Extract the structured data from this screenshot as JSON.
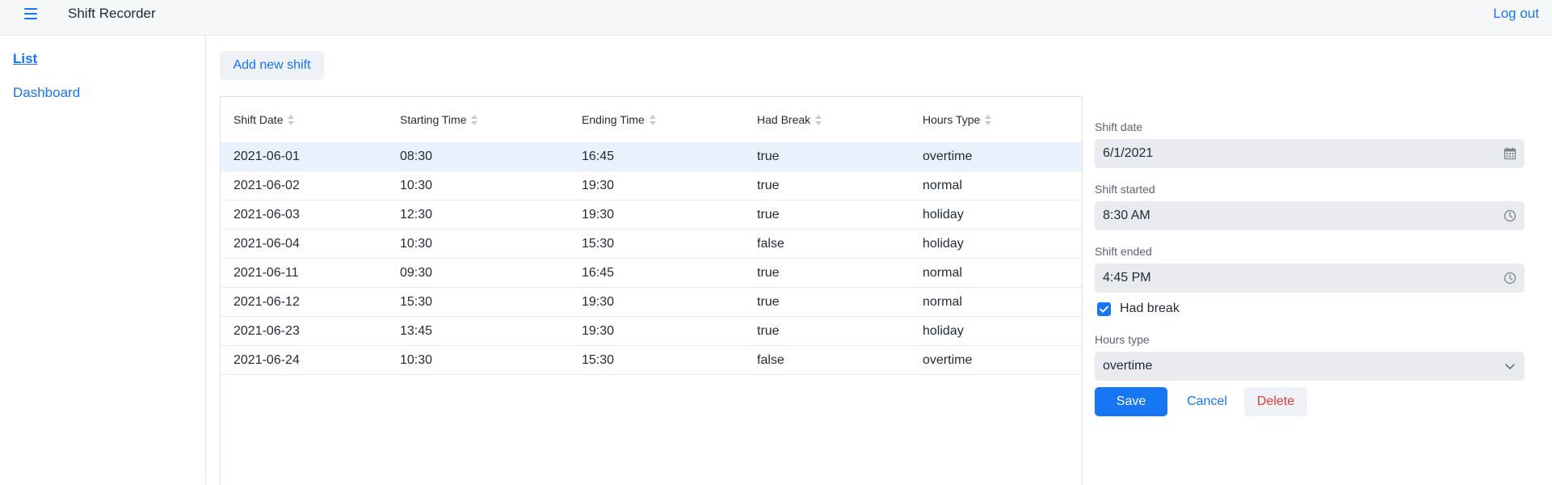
{
  "header": {
    "title": "Shift Recorder",
    "logout_label": "Log out"
  },
  "sidebar": {
    "items": [
      {
        "label": "List",
        "active": true
      },
      {
        "label": "Dashboard",
        "active": false
      }
    ]
  },
  "toolbar": {
    "add_label": "Add new shift"
  },
  "grid": {
    "columns": [
      "Shift Date",
      "Starting Time",
      "Ending Time",
      "Had Break",
      "Hours Type"
    ],
    "selected_row": 0,
    "rows": [
      [
        "2021-06-01",
        "08:30",
        "16:45",
        "true",
        "overtime"
      ],
      [
        "2021-06-02",
        "10:30",
        "19:30",
        "true",
        "normal"
      ],
      [
        "2021-06-03",
        "12:30",
        "19:30",
        "true",
        "holiday"
      ],
      [
        "2021-06-04",
        "10:30",
        "15:30",
        "false",
        "holiday"
      ],
      [
        "2021-06-11",
        "09:30",
        "16:45",
        "true",
        "normal"
      ],
      [
        "2021-06-12",
        "15:30",
        "19:30",
        "true",
        "normal"
      ],
      [
        "2021-06-23",
        "13:45",
        "19:30",
        "true",
        "holiday"
      ],
      [
        "2021-06-24",
        "10:30",
        "15:30",
        "false",
        "overtime"
      ]
    ]
  },
  "form": {
    "shift_date": {
      "label": "Shift date",
      "value": "6/1/2021",
      "icon": "calendar-icon"
    },
    "shift_started": {
      "label": "Shift started",
      "value": "8:30 AM",
      "icon": "clock-icon"
    },
    "shift_ended": {
      "label": "Shift ended",
      "value": "4:45 PM",
      "icon": "clock-icon"
    },
    "had_break": {
      "label": "Had break",
      "checked": true
    },
    "hours_type": {
      "label": "Hours type",
      "value": "overtime",
      "icon": "chevron-down-icon"
    },
    "save_label": "Save",
    "cancel_label": "Cancel",
    "delete_label": "Delete"
  },
  "colors": {
    "accent": "#1676f3",
    "danger": "#e53935",
    "selected_row": "#e9f1fd",
    "field_bg": "#e9ebee"
  }
}
